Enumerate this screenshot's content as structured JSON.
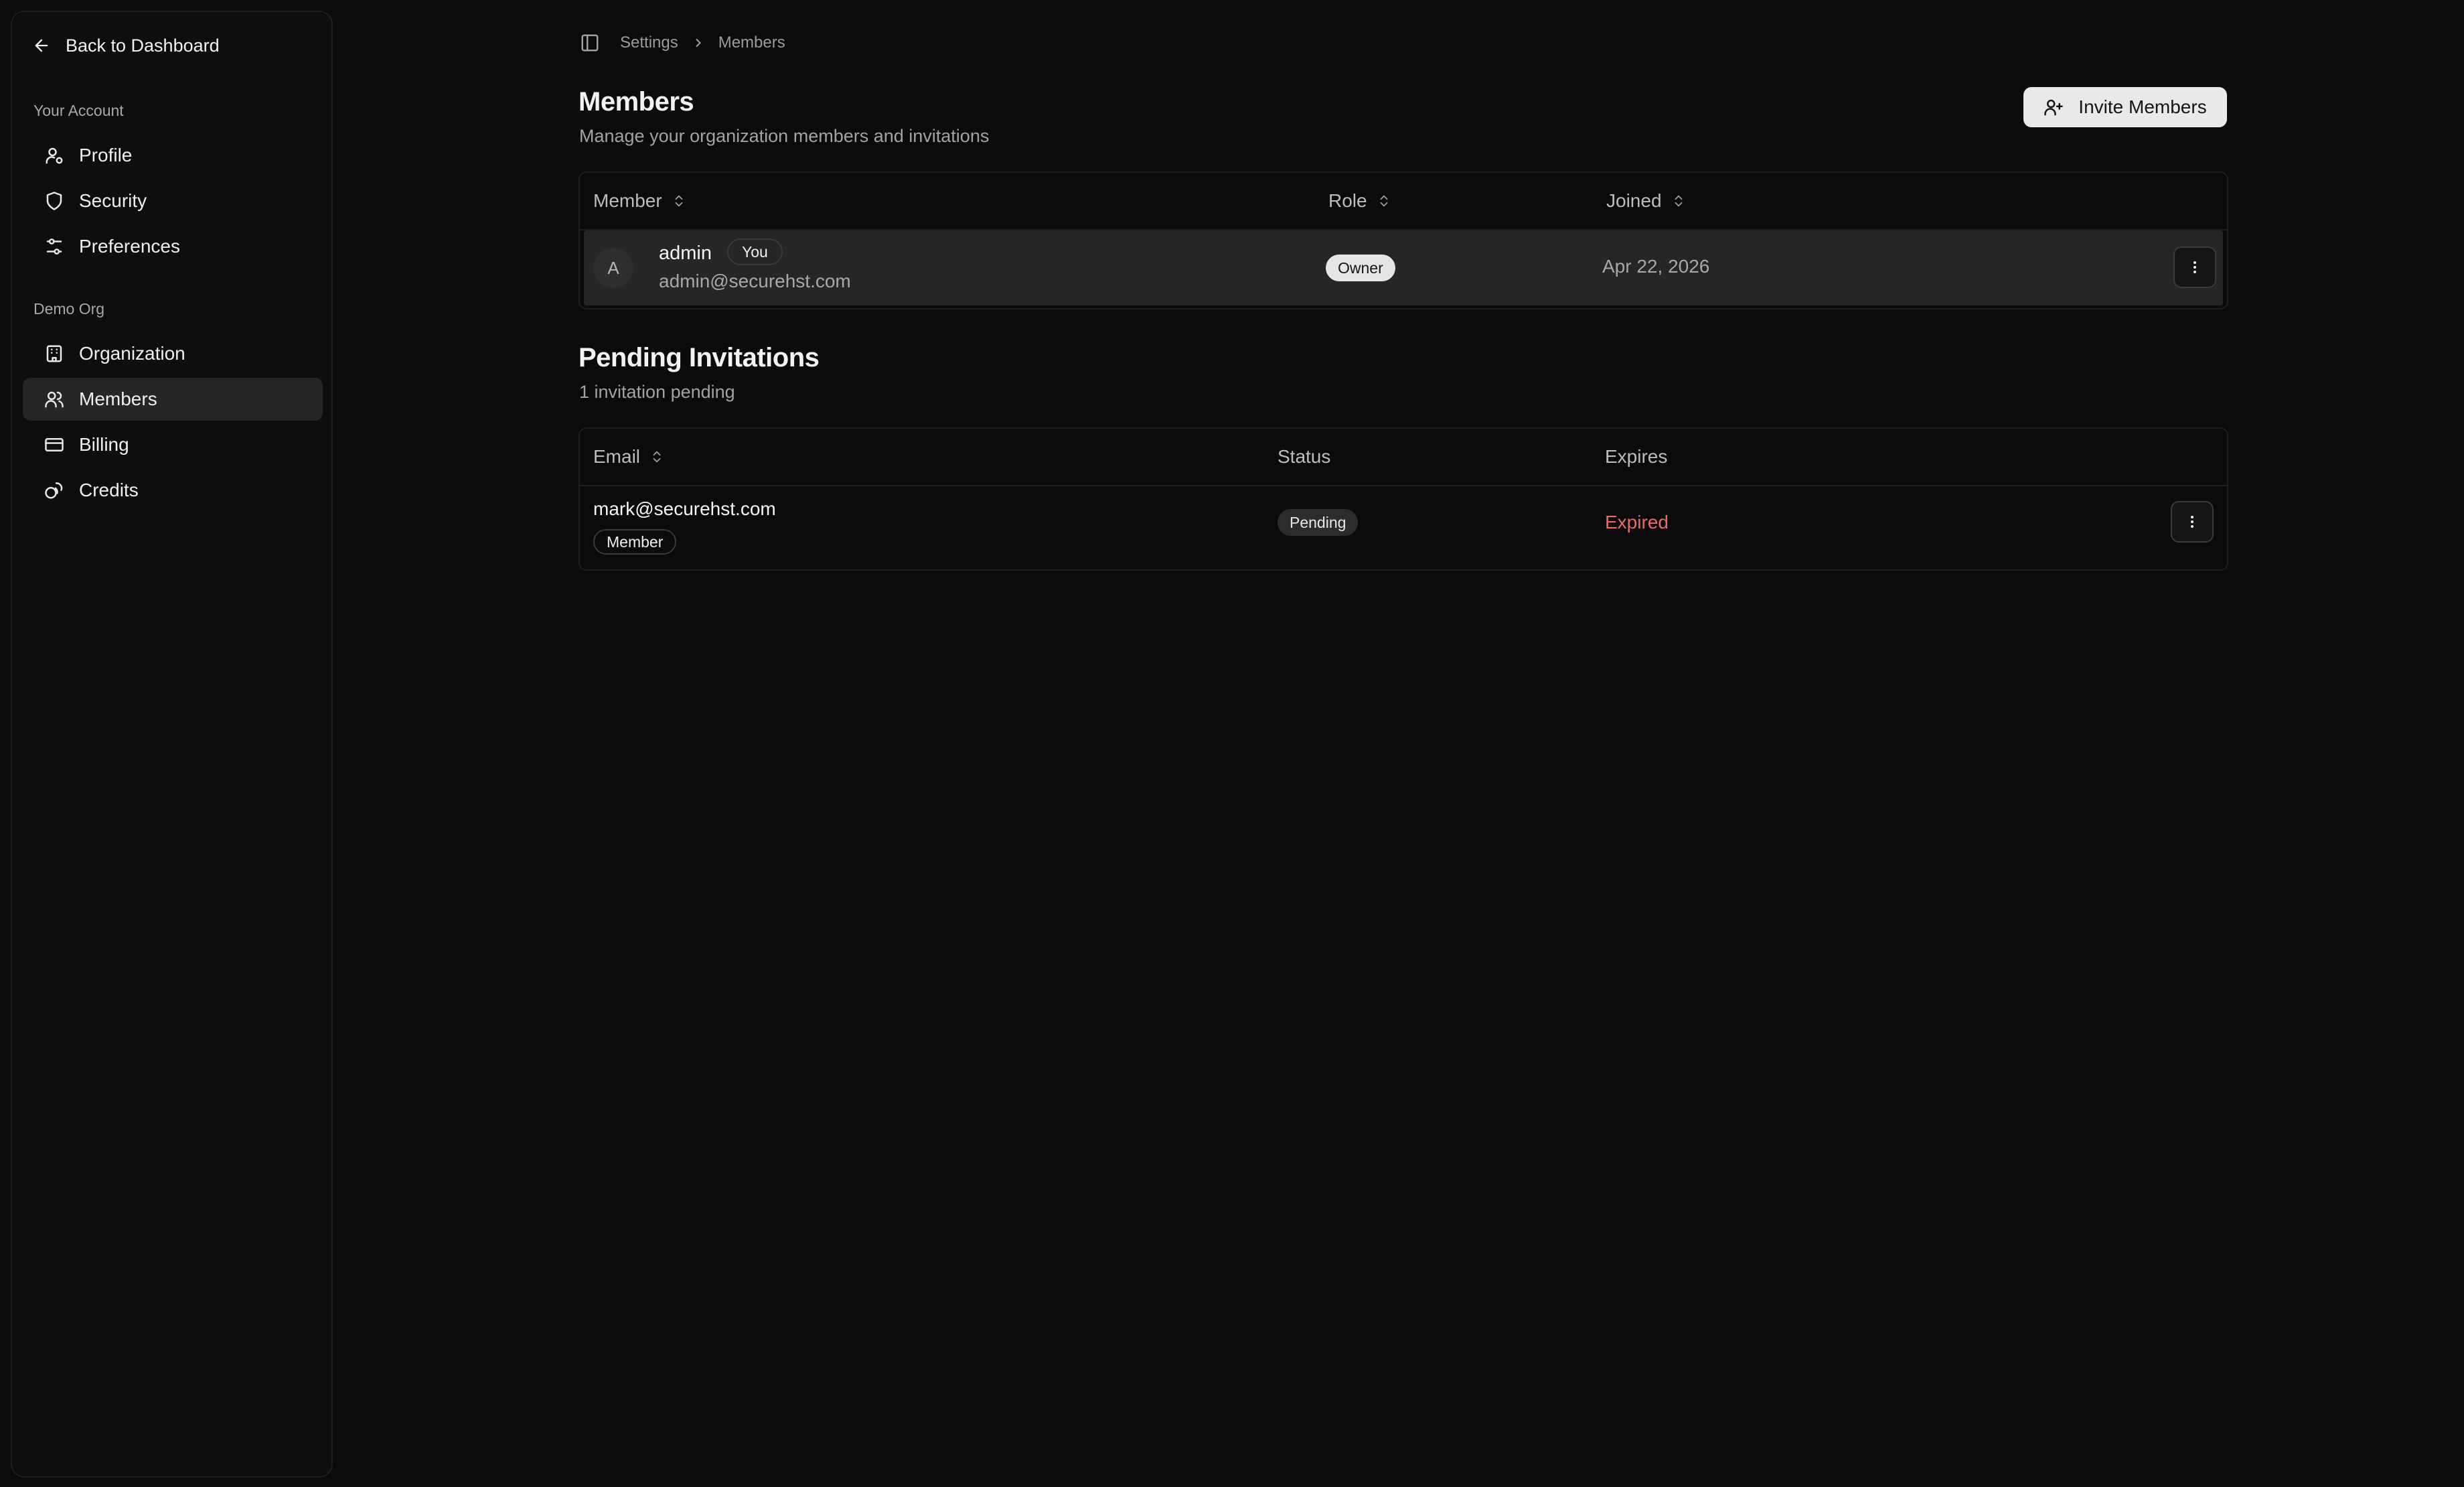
{
  "sidebar": {
    "back_label": "Back to Dashboard",
    "account_section": "Your Account",
    "account_items": [
      {
        "label": "Profile",
        "icon": "user-cog-icon"
      },
      {
        "label": "Security",
        "icon": "shield-icon"
      },
      {
        "label": "Preferences",
        "icon": "sliders-icon"
      }
    ],
    "org_section": "Demo Org",
    "org_items": [
      {
        "label": "Organization",
        "icon": "building-icon"
      },
      {
        "label": "Members",
        "icon": "users-icon",
        "active": true
      },
      {
        "label": "Billing",
        "icon": "credit-card-icon"
      },
      {
        "label": "Credits",
        "icon": "coins-icon"
      }
    ]
  },
  "breadcrumb": {
    "items": [
      "Settings",
      "Members"
    ]
  },
  "header": {
    "title": "Members",
    "subtitle": "Manage your organization members and invitations",
    "invite_button": "Invite Members"
  },
  "members_table": {
    "columns": [
      "Member",
      "Role",
      "Joined"
    ],
    "rows": [
      {
        "avatar_initial": "A",
        "name": "admin",
        "badge": "You",
        "email": "admin@securehst.com",
        "role": "Owner",
        "joined": "Apr 22, 2026"
      }
    ]
  },
  "invitations": {
    "title": "Pending Invitations",
    "subtitle": "1 invitation pending",
    "columns": [
      "Email",
      "Status",
      "Expires"
    ],
    "rows": [
      {
        "email": "mark@securehst.com",
        "role": "Member",
        "status": "Pending",
        "expires": "Expired"
      }
    ]
  },
  "colors": {
    "background": "#0b0b0b",
    "active_nav": "#262626",
    "expired_text": "#f06a62",
    "button_bg": "#e9e9e9"
  }
}
